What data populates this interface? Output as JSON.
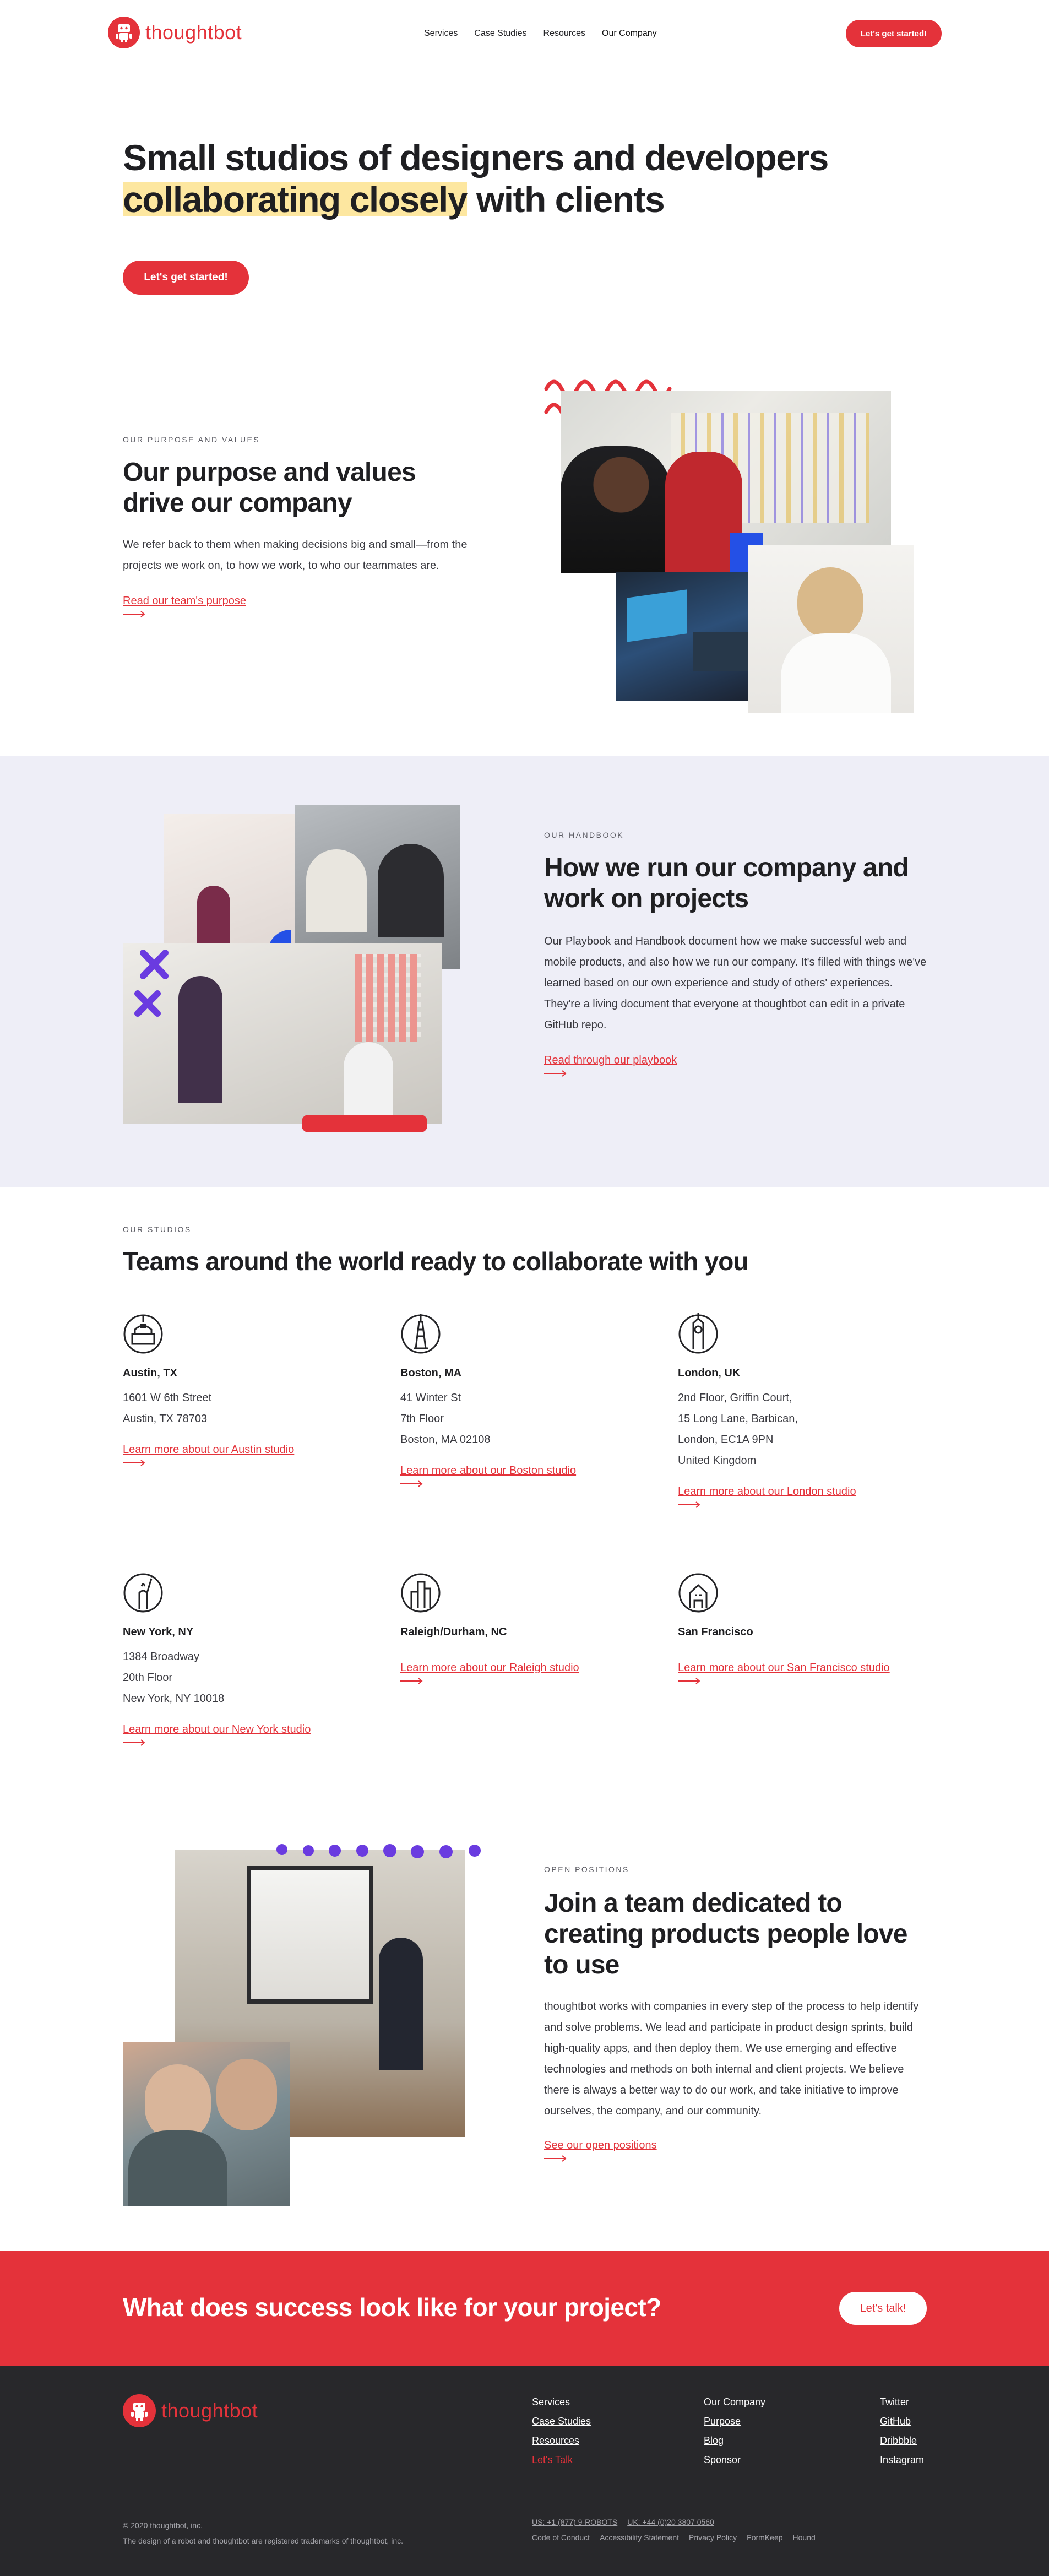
{
  "header": {
    "logo_text": "thoughtbot",
    "nav": [
      "Services",
      "Case Studies",
      "Resources",
      "Our Company"
    ],
    "cta": "Let's get started!"
  },
  "hero": {
    "title_highlight": "collaborating closely",
    "title_line1": "Small studios of designers and developers",
    "title_rest": " with clients",
    "cta": "Let's get started!"
  },
  "purpose": {
    "eyebrow": "OUR PURPOSE AND VALUES",
    "title": "Our purpose and values drive our company",
    "body": "We refer back to them when making decisions big and small—from the projects we work on, to how we work, to who our teammates are.",
    "link": "Read our team's purpose"
  },
  "handbook": {
    "eyebrow": "OUR HANDBOOK",
    "title": "How we run our company and work on projects",
    "body": "Our Playbook and Handbook document how we make successful web and mobile products, and also how we run our company. It's filled with things we've learned based on our own experience and study of others' experiences. They're a living document that everyone at thoughtbot can edit in a private GitHub repo.",
    "link": "Read through our playbook"
  },
  "studios": {
    "eyebrow": "OUR STUDIOS",
    "title": "Teams around the world ready to collaborate with you",
    "items": [
      {
        "icon": "austin-capitol-icon",
        "name": "Austin, TX",
        "address": [
          "1601 W 6th Street",
          "Austin, TX 78703"
        ],
        "link": "Learn more about our Austin studio"
      },
      {
        "icon": "boston-tower-icon",
        "name": "Boston, MA",
        "address": [
          "41 Winter St",
          "7th Floor",
          "Boston, MA 02108"
        ],
        "link": "Learn more about our Boston studio"
      },
      {
        "icon": "london-big-ben-icon",
        "name": "London, UK",
        "address": [
          "2nd Floor, Griffin Court,",
          "15 Long Lane, Barbican,",
          "London, EC1A 9PN",
          "United Kingdom"
        ],
        "link": "Learn more about our London studio"
      },
      {
        "icon": "new-york-liberty-icon",
        "name": "New York, NY",
        "address": [
          "1384 Broadway",
          "20th Floor",
          "New York, NY 10018"
        ],
        "link": "Learn more about our New York studio"
      },
      {
        "icon": "raleigh-buildings-icon",
        "name": "Raleigh/Durham, NC",
        "address": [],
        "link": "Learn more about our Raleigh studio"
      },
      {
        "icon": "san-francisco-house-icon",
        "name": "San Francisco",
        "address": [],
        "link": "Learn more about our San Francisco studio"
      }
    ]
  },
  "positions": {
    "eyebrow": "OPEN POSITIONS",
    "title": "Join a team dedicated to creating products people love to use",
    "body": "thoughtbot works with companies in every step of the process to help identify and solve problems. We lead and participate in product design sprints, build high-quality apps, and then deploy them. We use emerging and effective technologies and methods on both internal and client projects. We believe there is always a better way to do our work, and take initiative to improve ourselves, the company, and our community.",
    "link": "See our open positions"
  },
  "cta_band": {
    "title": "What does success look like for your project?",
    "button": "Let's talk!"
  },
  "footer": {
    "logo_text": "thoughtbot",
    "col1": [
      "Services",
      "Case Studies",
      "Resources",
      "Let's Talk"
    ],
    "col2": [
      "Our Company",
      "Purpose",
      "Blog",
      "Sponsor"
    ],
    "col3": [
      "Twitter",
      "GitHub",
      "Dribbble",
      "Instagram"
    ],
    "copyright": "© 2020 thoughtbot, inc.",
    "trademark": "The design of a robot and thoughtbot are registered trademarks of thoughtbot, inc.",
    "phones": [
      "US: +1 (877) 9-ROBOTS",
      "UK: +44 (0)20 3807 0560"
    ],
    "legal": [
      "Code of Conduct",
      "Accessibility Statement",
      "Privacy Policy",
      "FormKeep",
      "Hound"
    ]
  },
  "colors": {
    "brand_red": "#e4323a",
    "highlight_yellow": "#fde7a0",
    "handbook_bg": "#eeeef7",
    "accent_purple": "#6a3be0",
    "accent_blue": "#1f5cf0",
    "footer_bg": "#28282b"
  }
}
